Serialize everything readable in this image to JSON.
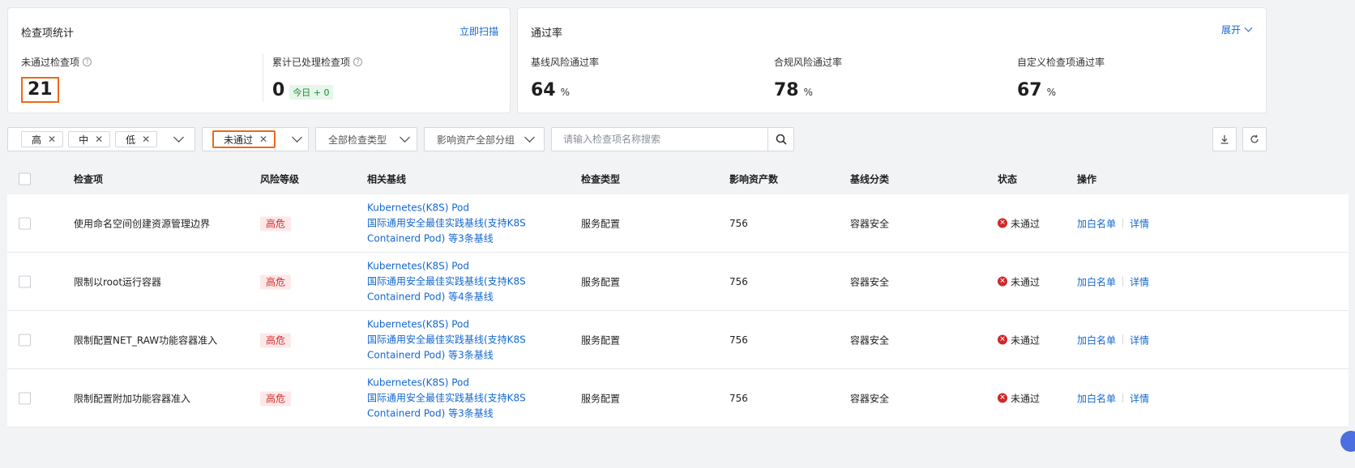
{
  "stats_card": {
    "title": "检查项统计",
    "scan_link": "立即扫描",
    "failed": {
      "label": "未通过检查项",
      "value": "21"
    },
    "handled": {
      "label": "累计已处理检查项",
      "value": "0",
      "today": "今日 + 0"
    }
  },
  "rate_card": {
    "title": "通过率",
    "expand": "展开",
    "items": [
      {
        "label": "基线风险通过率",
        "value": "64",
        "unit": "%"
      },
      {
        "label": "合规风险通过率",
        "value": "78",
        "unit": "%"
      },
      {
        "label": "自定义检查项通过率",
        "value": "67",
        "unit": "%"
      }
    ]
  },
  "filters": {
    "risk_tags": [
      "高",
      "中",
      "低"
    ],
    "status_tag": "未通过",
    "check_type": "全部检查类型",
    "asset_group": "影响资产全部分组",
    "search_placeholder": "请输入检查项名称搜索"
  },
  "table": {
    "headers": [
      "检查项",
      "风险等级",
      "相关基线",
      "检查类型",
      "影响资产数",
      "基线分类",
      "状态",
      "操作"
    ],
    "rows": [
      {
        "name": "使用命名空间创建资源管理边界",
        "risk": "高危",
        "baseline_1": "Kubernetes(K8S) Pod",
        "baseline_2": "国际通用安全最佳实践基线(支持K8S",
        "baseline_3": "Containerd Pod) 等3条基线",
        "type": "服务配置",
        "assets": "756",
        "category": "容器安全",
        "status": "未通过",
        "action_whitelist": "加白名单",
        "action_detail": "详情"
      },
      {
        "name": "限制以root运行容器",
        "risk": "高危",
        "baseline_1": "Kubernetes(K8S) Pod",
        "baseline_2": "国际通用安全最佳实践基线(支持K8S",
        "baseline_3": "Containerd Pod) 等4条基线",
        "type": "服务配置",
        "assets": "756",
        "category": "容器安全",
        "status": "未通过",
        "action_whitelist": "加白名单",
        "action_detail": "详情"
      },
      {
        "name": "限制配置NET_RAW功能容器准入",
        "risk": "高危",
        "baseline_1": "Kubernetes(K8S) Pod",
        "baseline_2": "国际通用安全最佳实践基线(支持K8S",
        "baseline_3": "Containerd Pod) 等3条基线",
        "type": "服务配置",
        "assets": "756",
        "category": "容器安全",
        "status": "未通过",
        "action_whitelist": "加白名单",
        "action_detail": "详情"
      },
      {
        "name": "限制配置附加功能容器准入",
        "risk": "高危",
        "baseline_1": "Kubernetes(K8S) Pod",
        "baseline_2": "国际通用安全最佳实践基线(支持K8S",
        "baseline_3": "Containerd Pod) 等3条基线",
        "type": "服务配置",
        "assets": "756",
        "category": "容器安全",
        "status": "未通过",
        "action_whitelist": "加白名单",
        "action_detail": "详情"
      }
    ]
  }
}
